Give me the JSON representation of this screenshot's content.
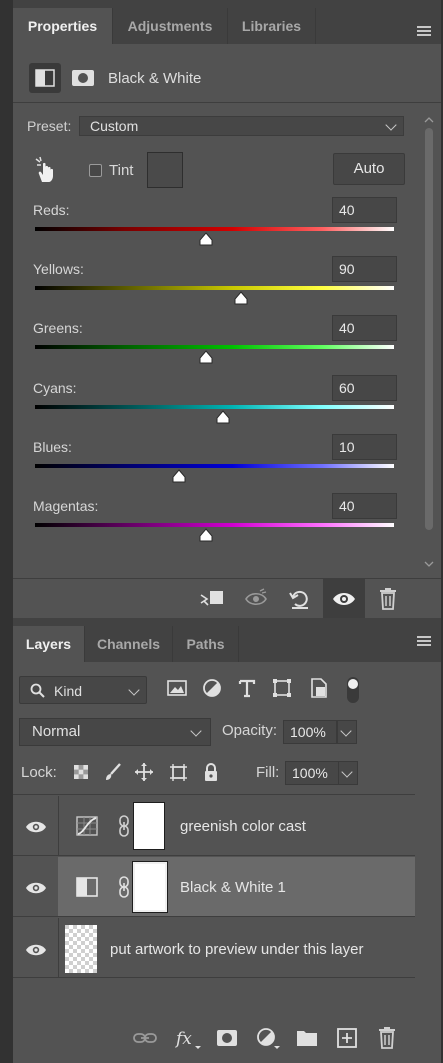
{
  "properties_panel": {
    "tabs": [
      {
        "label": "Properties",
        "active": true
      },
      {
        "label": "Adjustments",
        "active": false
      },
      {
        "label": "Libraries",
        "active": false
      }
    ],
    "title": "Black & White",
    "preset_label": "Preset:",
    "preset_value": "Custom",
    "tint_label": "Tint",
    "tint_checked": false,
    "auto_label": "Auto",
    "sliders": [
      {
        "label": "Reds:",
        "value": "40",
        "level": 0.475,
        "gradient": "linear-gradient(to right,#000,#7a0000 25%,#d40000 55%,#ff6060 80%,#fff)"
      },
      {
        "label": "Yellows:",
        "value": "90",
        "level": 0.575,
        "gradient": "linear-gradient(to right,#000,#5a5a00 25%,#c8c800 55%,#ffff40 80%,#fff)"
      },
      {
        "label": "Greens:",
        "value": "40",
        "level": 0.475,
        "gradient": "linear-gradient(to right,#000,#006000 25%,#00c000 55%,#60ff60 80%,#fff)"
      },
      {
        "label": "Cyans:",
        "value": "60",
        "level": 0.525,
        "gradient": "linear-gradient(to right,#000,#005050 25%,#00b4b4 55%,#80ffff 80%,#fff)"
      },
      {
        "label": "Blues:",
        "value": "10",
        "level": 0.4,
        "gradient": "linear-gradient(to right,#000,#00006a 25%,#0000d8 55%,#7070ff 80%,#fff)"
      },
      {
        "label": "Magentas:",
        "value": "40",
        "level": 0.475,
        "gradient": "linear-gradient(to right,#000,#600060 25%,#d000d0 55%,#ff70ff 80%,#fff)"
      }
    ]
  },
  "layers_panel": {
    "tabs": [
      {
        "label": "Layers",
        "active": true
      },
      {
        "label": "Channels",
        "active": false
      },
      {
        "label": "Paths",
        "active": false
      }
    ],
    "filter_kind": "Kind",
    "blend_mode": "Normal",
    "opacity_label": "Opacity:",
    "opacity_value": "100%",
    "lock_label": "Lock:",
    "fill_label": "Fill:",
    "fill_value": "100%",
    "layers": [
      {
        "name": "greenish color cast",
        "type": "curves",
        "selected": false
      },
      {
        "name": "Black & White 1",
        "type": "black-white",
        "selected": true
      },
      {
        "name": "put artwork to preview under this layer",
        "type": "pixel",
        "selected": false
      }
    ]
  },
  "colors": {
    "panel_bg": "#535353",
    "tab_bar_bg": "#424242",
    "selected_row": "#6a6a6a",
    "app_bg": "#323232"
  }
}
